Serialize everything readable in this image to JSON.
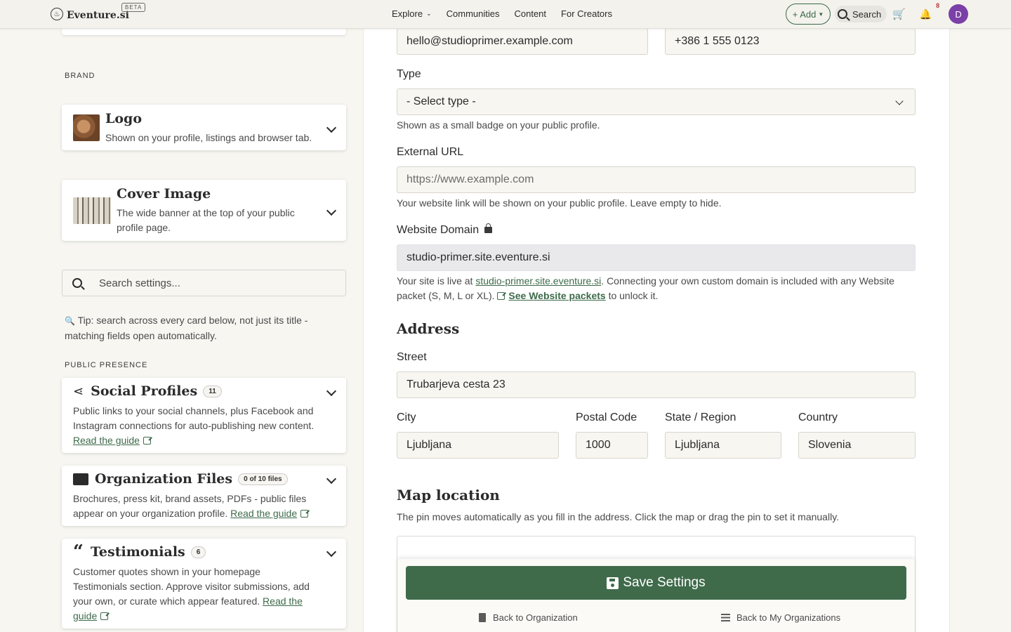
{
  "navbar": {
    "brand": "Eventure.si",
    "beta": "BETA",
    "links": [
      {
        "label": "Explore"
      },
      {
        "label": "Communities"
      },
      {
        "label": "Content"
      },
      {
        "label": "For Creators"
      }
    ],
    "add_label": "+ Add",
    "search_label": "Search",
    "notification_count": "8",
    "avatar_initial": "D"
  },
  "sidebar": {
    "brand_section": "BRAND",
    "logo": {
      "title": "Logo",
      "desc": "Shown on your profile, listings and browser tab."
    },
    "cover": {
      "title": "Cover Image",
      "desc": "The wide banner at the top of your public profile page."
    },
    "search_placeholder": "Search settings...",
    "tip": "Tip: search across every card below, not just its title - matching fields open automatically.",
    "public_section": "PUBLIC PRESENCE",
    "social": {
      "title": "Social Profiles",
      "badge": "11",
      "desc": "Public links to your social channels, plus Facebook and Instagram connections for auto-publishing new content.",
      "link": "Read the guide"
    },
    "files": {
      "title": "Organization Files",
      "badge": "0 of 10 files",
      "desc": "Brochures, press kit, brand assets, PDFs - public files appear on your organization profile.",
      "link": "Read the guide"
    },
    "testimonials": {
      "title": "Testimonials",
      "badge": "6",
      "desc": "Customer quotes shown in your homepage Testimonials section. Approve visitor submissions, add your own, or curate which appear featured.",
      "link": "Read the guide"
    }
  },
  "form": {
    "email": "hello@studioprimer.example.com",
    "phone": "+386 1 555 0123",
    "type_label": "Type",
    "type_value": "- Select type -",
    "type_help": "Shown as a small badge on your public profile.",
    "url_label": "External URL",
    "url_placeholder": "https://www.example.com",
    "url_help": "Your website link will be shown on your public profile. Leave empty to hide.",
    "domain_label": "Website Domain",
    "domain_value": "studio-primer.site.eventure.si",
    "domain_help_pre": "Your site is live at ",
    "domain_help_link": "studio-primer.site.eventure.si",
    "domain_help_mid": ". Connecting your own custom domain is included with any Website packet (S, M, L or XL). ",
    "domain_help_cta": "See Website packets",
    "domain_help_post": " to unlock it.",
    "address_heading": "Address",
    "street_label": "Street",
    "street_value": "Trubarjeva cesta 23",
    "city_label": "City",
    "city_value": "Ljubljana",
    "postal_label": "Postal Code",
    "postal_value": "1000",
    "state_label": "State / Region",
    "state_value": "Ljubljana",
    "country_label": "Country",
    "country_value": "Slovenia",
    "map_heading": "Map location",
    "map_help": "The pin moves automatically as you fill in the address. Click the map or drag the pin to set it manually."
  },
  "savebar": {
    "save_label": "Save Settings",
    "back_org": "Back to Organization",
    "back_my_orgs": "Back to My Organizations"
  }
}
